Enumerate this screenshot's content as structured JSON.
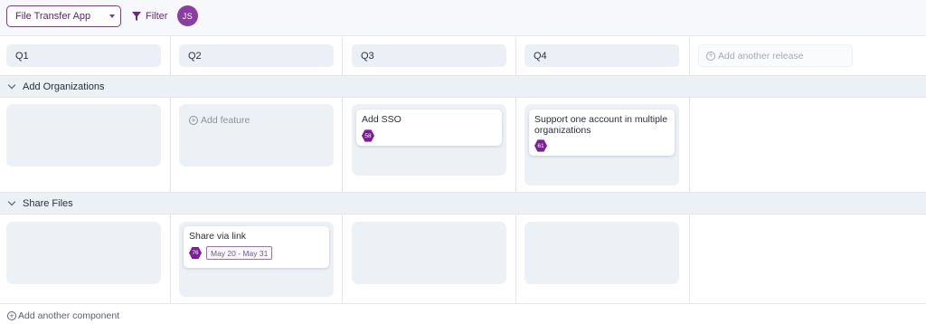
{
  "topbar": {
    "project_select": "File Transfer App",
    "filter_label": "Filter",
    "avatar_initials": "JS"
  },
  "releases": [
    "Q1",
    "Q2",
    "Q3",
    "Q4"
  ],
  "add_release_label": "Add another release",
  "add_feature_label": "Add feature",
  "add_component_label": "Add another component",
  "components": [
    {
      "name": "Add Organizations",
      "cards": [
        {
          "title": "Add SSO",
          "score": "58"
        },
        {
          "title": "Support one account in multiple organizations",
          "score": "61"
        }
      ]
    },
    {
      "name": "Share Files",
      "cards": [
        {
          "title": "Share via link",
          "score": "76",
          "date_range": "May 20 - May 31"
        }
      ]
    }
  ],
  "colors": {
    "accent": "#8b2e9e",
    "lane_bg": "#edf1f6",
    "badge_purple": "#7b1f95"
  }
}
